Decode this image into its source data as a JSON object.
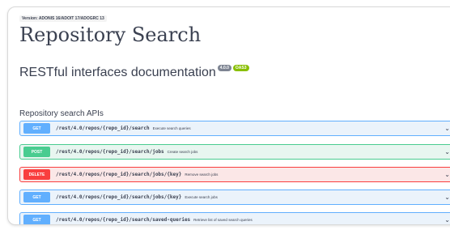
{
  "header": {
    "version_label": "Version: ADONIS 16/ADOIT 17/ADOGRC 13",
    "title": "Repository Search",
    "subtitle": "RESTful interfaces documentation",
    "badges": [
      "4.0.0",
      "OAS3"
    ]
  },
  "section": {
    "title": "Repository search APIs",
    "toggle_icon": "chevron-up-icon"
  },
  "operations": [
    {
      "method": "GET",
      "path": "/rest/4.0/repos/{repo_id}/search",
      "description": "Execute search queries"
    },
    {
      "method": "POST",
      "path": "/rest/4.0/repos/{repo_id}/search/jobs",
      "description": "Create search jobs"
    },
    {
      "method": "DELETE",
      "path": "/rest/4.0/repos/{repo_id}/search/jobs/{key}",
      "description": "Remove search jobs"
    },
    {
      "method": "GET",
      "path": "/rest/4.0/repos/{repo_id}/search/jobs/{key}",
      "description": "Execute search jobs"
    },
    {
      "method": "GET",
      "path": "/rest/4.0/repos/{repo_id}/search/saved-queries",
      "description": "Retrieve list of saved search queries"
    }
  ],
  "colors": {
    "get": "#61affe",
    "post": "#49cc90",
    "delete": "#f93e3e",
    "text": "#3b4151"
  }
}
